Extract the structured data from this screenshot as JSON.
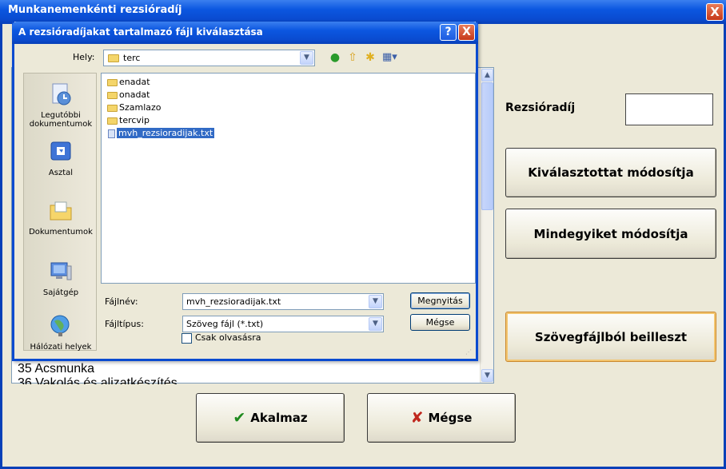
{
  "main": {
    "title": "Munkanemenkénti rezsióradíj",
    "close": "X",
    "list_rows": [
      "35 Acsmunka",
      "36 Vakolás és aljzatkészítés"
    ],
    "rezsi_label": "Rezsióradíj",
    "btn_modify_selected": "Kiválasztottat módosítja",
    "btn_modify_all": "Mindegyiket módosítja",
    "btn_paste_from_text": "Szövegfájlból beilleszt",
    "btn_apply": "Akalmaz",
    "btn_cancel": "Mégse"
  },
  "dialog": {
    "title": "A rezsióradíjakat tartalmazó fájl kiválasztása",
    "help": "?",
    "close": "X",
    "hely_label": "Hely:",
    "hely_value": "terc",
    "places": [
      "Legutóbbi dokumentumok",
      "Asztal",
      "Dokumentumok",
      "Sajátgép",
      "Hálózati helyek"
    ],
    "files": [
      {
        "name": "enadat",
        "kind": "folder"
      },
      {
        "name": "onadat",
        "kind": "folder"
      },
      {
        "name": "Szamlazo",
        "kind": "folder"
      },
      {
        "name": "tercvip",
        "kind": "folder"
      },
      {
        "name": "mvh_rezsioradijak.txt",
        "kind": "file",
        "selected": true
      }
    ],
    "filename_label": "Fájlnév:",
    "filename_value": "mvh_rezsioradijak.txt",
    "filetype_label": "Fájltípus:",
    "filetype_value": "Szöveg fájl (*.txt)",
    "open_button": "Megnyitás",
    "cancel_button": "Mégse",
    "readonly_label": "Csak olvasásra"
  },
  "colors": {
    "titlebar": "#0a4bd0",
    "selection": "#316ac5",
    "window_bg": "#ece9d8"
  }
}
